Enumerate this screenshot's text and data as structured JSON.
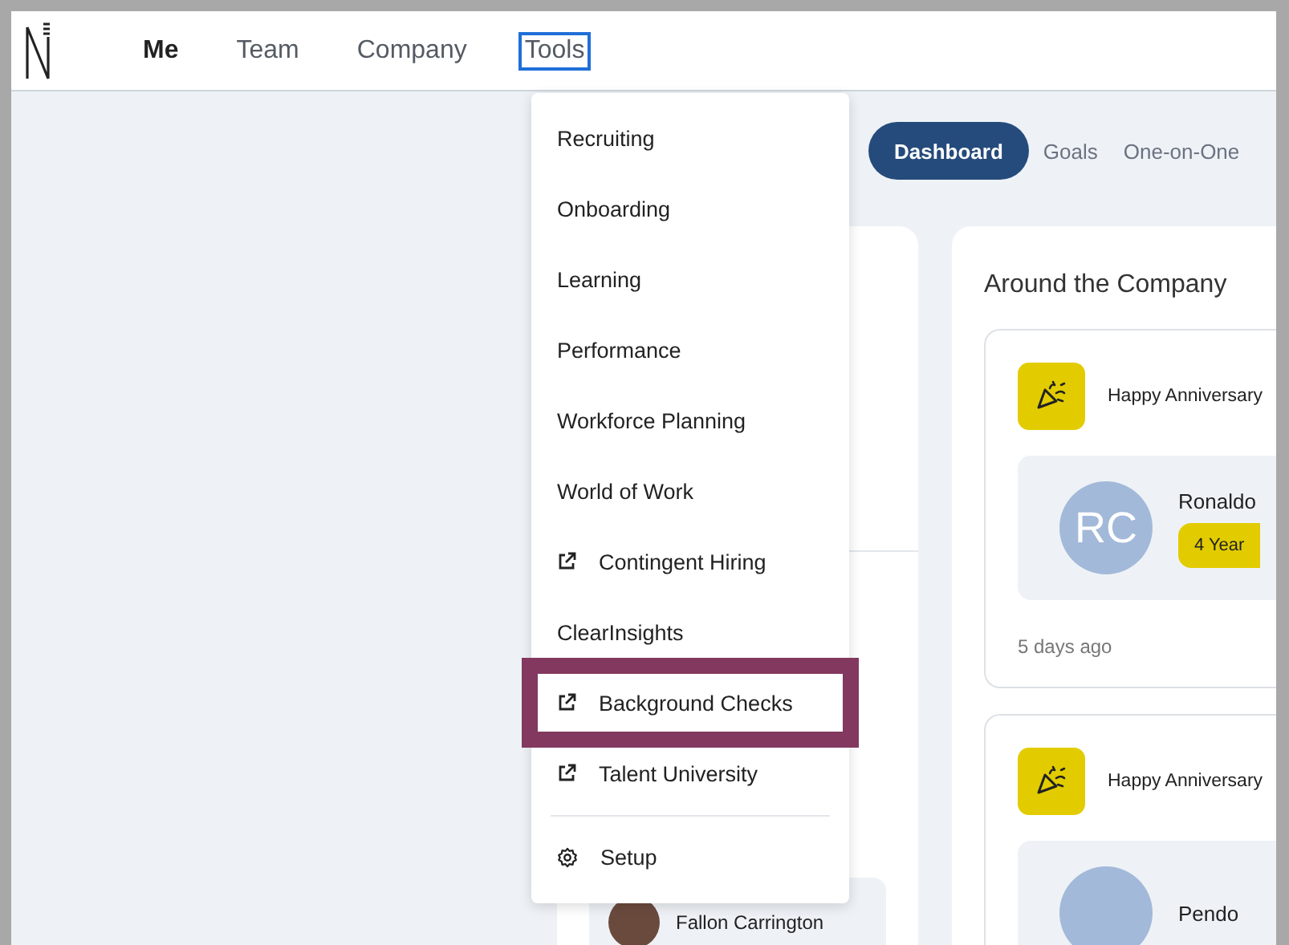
{
  "nav": {
    "items": [
      {
        "label": "Me",
        "selected": true,
        "focused": false
      },
      {
        "label": "Team",
        "selected": false,
        "focused": false
      },
      {
        "label": "Company",
        "selected": false,
        "focused": false
      },
      {
        "label": "Tools",
        "selected": false,
        "focused": true
      }
    ]
  },
  "menu": {
    "items": [
      {
        "label": "Recruiting",
        "kind": "link",
        "highlighted": false
      },
      {
        "label": "Onboarding",
        "kind": "link",
        "highlighted": false
      },
      {
        "label": "Learning",
        "kind": "link",
        "highlighted": false
      },
      {
        "label": "Performance",
        "kind": "link",
        "highlighted": false
      },
      {
        "label": "Workforce Planning",
        "kind": "link",
        "highlighted": false
      },
      {
        "label": "World of Work",
        "kind": "link",
        "highlighted": false
      },
      {
        "label": "Contingent Hiring",
        "kind": "external",
        "highlighted": false
      },
      {
        "label": "ClearInsights",
        "kind": "link",
        "highlighted": false
      },
      {
        "label": "Background Checks",
        "kind": "external",
        "highlighted": true
      },
      {
        "label": "Talent University",
        "kind": "external",
        "highlighted": false
      },
      {
        "label": "Setup",
        "kind": "settings",
        "highlighted": false
      }
    ]
  },
  "tabs": [
    {
      "label": "Dashboard",
      "selected": true
    },
    {
      "label": "Goals",
      "selected": false
    },
    {
      "label": "One-on-One",
      "selected": false
    }
  ],
  "left_card": {
    "person": {
      "name": "Fallon Carrington"
    }
  },
  "around": {
    "title": "Around the Company",
    "events": [
      {
        "heading": "Happy Anniversary",
        "initials": "RC",
        "name": "Ronaldo",
        "badge": "4 Year",
        "time": "5 days ago"
      },
      {
        "heading": "Happy Anniversary",
        "name": "Pendo"
      }
    ]
  }
}
